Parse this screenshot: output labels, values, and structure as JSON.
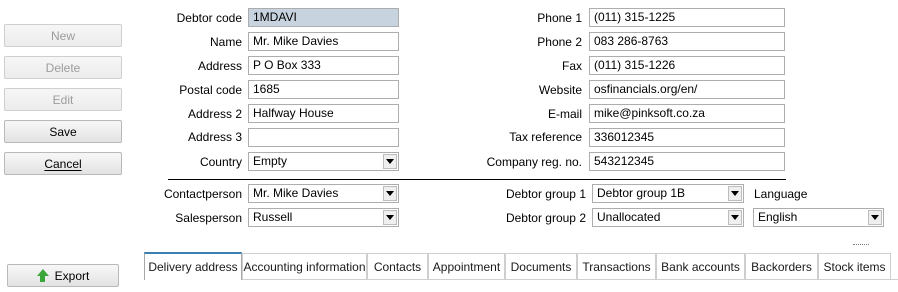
{
  "actions": {
    "new": "New",
    "delete": "Delete",
    "edit": "Edit",
    "save": "Save",
    "cancel": "Cancel",
    "export": "Export"
  },
  "left_fields": {
    "debtor_code": {
      "label": "Debtor code",
      "value": "1MDAVI"
    },
    "name": {
      "label": "Name",
      "value": "Mr. Mike Davies"
    },
    "address": {
      "label": "Address",
      "value": "P O Box 333"
    },
    "postal_code": {
      "label": "Postal code",
      "value": "1685"
    },
    "address2": {
      "label": "Address 2",
      "value": "Halfway House"
    },
    "address3": {
      "label": "Address 3",
      "value": ""
    },
    "country": {
      "label": "Country",
      "value": "Empty"
    }
  },
  "right_fields": {
    "phone1": {
      "label": "Phone 1",
      "value": "(011) 315-1225"
    },
    "phone2": {
      "label": "Phone 2",
      "value": "083 286-8763"
    },
    "fax": {
      "label": "Fax",
      "value": "(011) 315-1226"
    },
    "website": {
      "label": "Website",
      "value": "osfinancials.org/en/"
    },
    "email": {
      "label": "E-mail",
      "value": "mike@pinksoft.co.za"
    },
    "tax_reference": {
      "label": "Tax reference",
      "value": "336012345"
    },
    "company_reg": {
      "label": "Company reg. no.",
      "value": "543212345"
    }
  },
  "lower": {
    "contactperson": {
      "label": "Contactperson",
      "value": "Mr. Mike Davies"
    },
    "salesperson": {
      "label": "Salesperson",
      "value": "Russell"
    },
    "debtor_group1": {
      "label": "Debtor group 1",
      "value": "Debtor group 1B"
    },
    "debtor_group2": {
      "label": "Debtor group 2",
      "value": "Unallocated"
    },
    "language": {
      "label": "Language",
      "value": "English"
    }
  },
  "tabs": [
    {
      "label": "Delivery address",
      "active": true
    },
    {
      "label": "Accounting information"
    },
    {
      "label": "Contacts"
    },
    {
      "label": "Appointment"
    },
    {
      "label": "Documents"
    },
    {
      "label": "Transactions"
    },
    {
      "label": "Bank accounts"
    },
    {
      "label": "Backorders"
    },
    {
      "label": "Stock items"
    }
  ],
  "colors": {
    "selected_field": "#c7d3de",
    "active_tab_accent": "#3c7fb1",
    "export_arrow": "#3aa63a"
  }
}
